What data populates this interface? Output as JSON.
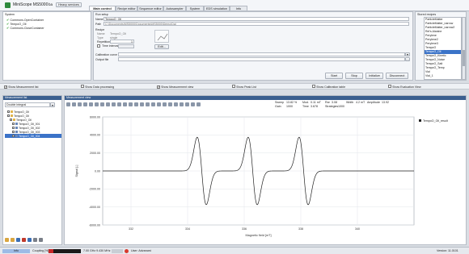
{
  "title_bar": {
    "app_title": "MiniScope MS5000",
    "user_suffix": "ba",
    "badge": "Heavy services"
  },
  "tabs": [
    {
      "label": "Main control",
      "active": true
    },
    {
      "label": "Recipe editor",
      "active": false
    },
    {
      "label": "Sequence editor",
      "active": false
    },
    {
      "label": "Autosampler",
      "active": false
    },
    {
      "label": "System",
      "active": false
    },
    {
      "label": "EDS simulation",
      "active": false
    },
    {
      "label": "Info",
      "active": false
    }
  ],
  "system_panel": {
    "header": "System",
    "items": [
      "Commons.OpenContainer",
      "TempoO_Oil",
      "Commons.CloseContainer"
    ]
  },
  "run_setup": {
    "header": "Run setup",
    "name_label": "Name",
    "name_value": "TempoO_Oil",
    "path_label": "Path",
    "path_value": "C:\\Documents\\MS5000\\Documents\\MS5000\\Demo\\Dal",
    "recipe_label": "Recipe",
    "recipe_name_label": "Name",
    "recipe_name_value": "TempoO_Oil",
    "recipe_type_label": "Type",
    "recipe_type_value": "single",
    "repetitions_label": "Repetitions",
    "repetitions_value": "1",
    "time_interval_label": "Time interval",
    "edit_label": "Edit...",
    "calibration_label": "Calibration curve",
    "output_label": "Output file",
    "start_label": "Start",
    "stop_label": "Stop",
    "initialize_label": "Initialize",
    "disconnect_label": "Disconnect"
  },
  "stored_recipes": {
    "header": "Stored recipes",
    "items": [
      "ParticleMatter",
      "ParticleMatter_narrow",
      "ParticleMatter_narrow2",
      "Rel's.Alanine",
      "Perylene",
      "Perylene2",
      "Perylene3",
      "TempoO",
      "TempoO_Oil",
      "TempoO_Kinetic",
      "TempoO_Noise",
      "TempoO_Salt",
      "TempoO_Temp",
      "Vial",
      "Vial_1"
    ],
    "selected": "TempoO_Oil"
  },
  "options": [
    {
      "label": "Show Measurement list",
      "checked": true
    },
    {
      "label": "Show Data processing",
      "checked": false
    },
    {
      "label": "Show Measurement view",
      "checked": true
    },
    {
      "label": "Show Peak List",
      "checked": false
    },
    {
      "label": "Show Calibration table",
      "checked": false
    },
    {
      "label": "Show Evaluation View",
      "checked": false
    }
  ],
  "measurement_list": {
    "header": "Measurement list",
    "mode": "Double integral",
    "tree": [
      {
        "label": "TempoO_Oil",
        "level": 1
      },
      {
        "label": "TempoO_Oil",
        "level": 1
      },
      {
        "label": "TempoO_Oil",
        "level": 2
      },
      {
        "label": "TempoO_Oil_001",
        "level": 3
      },
      {
        "label": "TempoO_Oil_002",
        "level": 3
      },
      {
        "label": "TempoO_Oil_003",
        "level": 3
      },
      {
        "label": "TempoO_Oil_004",
        "level": 3
      }
    ]
  },
  "measurement_view": {
    "header": "Measurement view",
    "info": [
      {
        "label": "Sweep",
        "value": "13.82 %"
      },
      {
        "label": "Mod.",
        "value": "0.11 mT"
      },
      {
        "label": "Rxn",
        "value": "3.08"
      },
      {
        "label": "Width",
        "value": "4.2 mT"
      },
      {
        "label": "Gain",
        "value": "1000"
      },
      {
        "label": "Time",
        "value": "3.678"
      },
      {
        "label": "Strategies",
        "value": "1000"
      },
      {
        "label": "Amplitude",
        "value": "13.92"
      }
    ]
  },
  "chart_data": {
    "type": "line",
    "title": "",
    "xlabel": "Magnetic field [mT]",
    "ylabel": "Signal [-]",
    "xlim": [
      331,
      342
    ],
    "ylim": [
      -6000,
      6000
    ],
    "xticks": [
      332,
      334,
      336,
      338,
      340
    ],
    "yticks": [
      6000,
      4000,
      2000,
      0,
      -2000,
      -4000,
      -6000
    ],
    "grid": true,
    "legend_position": "top-right",
    "series": [
      {
        "name": "TempoO_Oil_result",
        "color": "#222222",
        "centers": [
          334.5,
          336.3,
          338.1
        ],
        "amplitude": 5300,
        "width": 0.16
      }
    ]
  },
  "status_bar": {
    "info_tab": "Info",
    "coupling": "Coupling [%]",
    "frequency": "7.00 GHz  9.430 MHz",
    "user": "User: Advanced",
    "version": "Version: 11.0101"
  },
  "colors": {
    "accent": "#1a56b0",
    "selection": "#3b73c8",
    "green_check": "#2a9a2a"
  }
}
